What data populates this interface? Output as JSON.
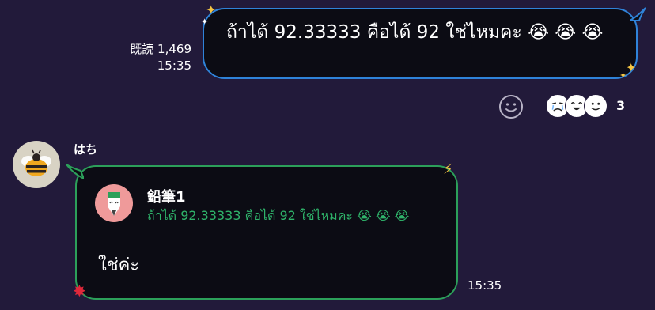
{
  "outgoing": {
    "text": "ถ้าได้ 92.33333 คือได้ 92 ใช่ไหมคะ 😭 😭 😭",
    "read_label": "既読 1,469",
    "time": "15:35",
    "border_color": "#2f83d9"
  },
  "reactions": {
    "add_icon": "smiley-outline-icon",
    "faces": [
      "crying-face-sticker",
      "laughing-face-sticker",
      "smiling-face-sticker"
    ],
    "count": "3"
  },
  "incoming": {
    "sender": "はち",
    "avatar_icon": "bee-icon",
    "reply": {
      "title": "鉛筆1",
      "text": "ถ้าได้ 92.33333 คือได้ 92 ใช่ไหมคะ 😭 😭 😭",
      "icon": "pencil-icon"
    },
    "text": "ใช่ค่ะ",
    "time": "15:35",
    "border_color": "#2ca05a"
  }
}
